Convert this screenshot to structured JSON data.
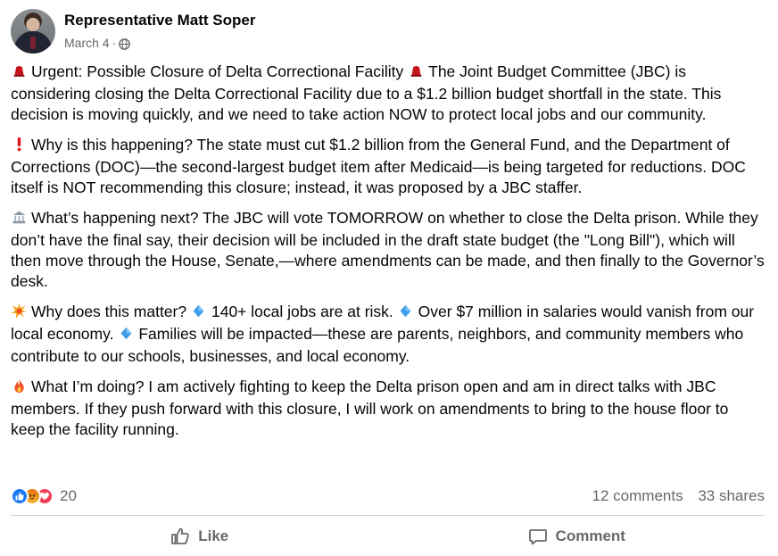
{
  "post": {
    "author": "Representative Matt Soper",
    "date": "March 4",
    "separator": "·",
    "privacy_icon": "globe-icon",
    "paragraphs": [
      {
        "icon": "red-hat-icon",
        "text": "Urgent: Possible Closure of Delta Correctional Facility",
        "icon2": "red-hat-icon",
        "text2": "The Joint Budget Committee (JBC) is considering closing the Delta Correctional Facility due to a $1.2 billion budget shortfall in the state. This decision is moving quickly, and we need to take action NOW to protect local jobs and our community."
      },
      {
        "icon": "exclamation-icon",
        "text": "Why is this happening? The state must cut $1.2 billion from the General Fund, and the Department of Corrections (DOC)—the second-largest budget item after Medicaid—is being targeted for reductions. DOC itself is NOT recommending this closure; instead, it was proposed by a JBC staffer."
      },
      {
        "icon": "classical-building-icon",
        "text": "What’s happening next? The JBC will vote TOMORROW on whether to close the Delta prison. While they don’t have the final say, their decision will be included in the draft state budget (the \"Long Bill\"), which will then move through the House, Senate,—where amendments can be made, and then finally to the Governor’s desk."
      },
      {
        "icon": "collision-icon",
        "text": "Why does this matter?",
        "bullets": [
          "140+ local jobs are at risk.",
          "Over $7 million in salaries would vanish from our local economy.",
          "Families will be impacted—these are parents, neighbors, and community members who contribute to our schools, businesses, and local economy."
        ],
        "bullet_icon": "blue-diamond-icon"
      },
      {
        "icon": "fire-icon",
        "text": "What I’m doing?   I am actively fighting to keep the Delta prison open and am in direct talks with JBC members. If they push forward with this closure, I will work on amendments to bring to the house floor to keep the facility running."
      }
    ]
  },
  "stats": {
    "reactions_count": "20",
    "reaction_icons": [
      "like-icon",
      "angry-icon",
      "love-icon"
    ],
    "comments": "12 comments",
    "shares": "33 shares"
  },
  "actions": {
    "like": "Like",
    "comment": "Comment"
  },
  "colors": {
    "text": "#050505",
    "secondary": "#65676b",
    "like_blue": "#1877f2",
    "love_red": "#f33e58",
    "divider": "#ced0d4"
  }
}
